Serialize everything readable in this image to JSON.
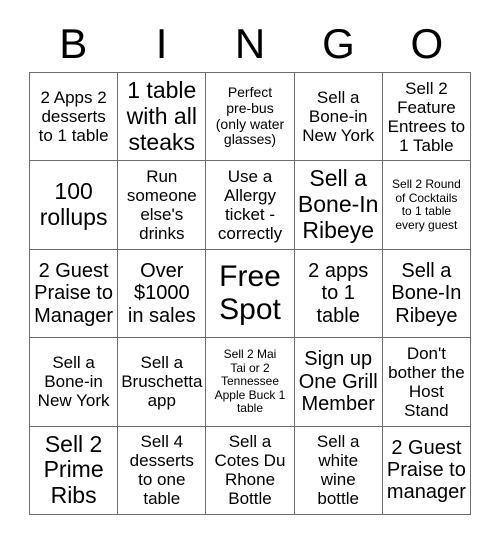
{
  "card": {
    "header_letters": [
      "B",
      "I",
      "N",
      "G",
      "O"
    ],
    "grid": {
      "columns": 5,
      "rows": 5,
      "border_color": "#6e6e6e",
      "background_color": "#ffffff",
      "text_color": "#000000"
    },
    "cells": [
      {
        "text": "2 Apps 2\ndesserts\nto 1 table",
        "size": "md",
        "free": false
      },
      {
        "text": "1 table\nwith all\nsteaks",
        "size": "xl",
        "free": false
      },
      {
        "text": "Perfect\npre-bus\n(only water\nglasses)",
        "size": "sm",
        "free": false
      },
      {
        "text": "Sell a\nBone-in\nNew York",
        "size": "md",
        "free": false
      },
      {
        "text": "Sell 2\nFeature\nEntrees to\n1 Table",
        "size": "md",
        "free": false
      },
      {
        "text": "100\nrollups",
        "size": "xl",
        "free": false
      },
      {
        "text": "Run\nsomeone\nelse's\ndrinks",
        "size": "md",
        "free": false
      },
      {
        "text": "Use a\nAllergy\nticket -\ncorrectly",
        "size": "md",
        "free": false
      },
      {
        "text": "Sell a\nBone-In\nRibeye",
        "size": "xl",
        "free": false
      },
      {
        "text": "Sell 2 Round\nof Cocktails\nto 1 table\nevery guest",
        "size": "xs",
        "free": false
      },
      {
        "text": "2 Guest\nPraise to\nManager",
        "size": "lg",
        "free": false
      },
      {
        "text": "Over\n$1000\nin sales",
        "size": "lg",
        "free": false
      },
      {
        "text": "Free\nSpot",
        "size": "xxl",
        "free": true
      },
      {
        "text": "2 apps\nto 1\ntable",
        "size": "lg",
        "free": false
      },
      {
        "text": "Sell a\nBone-In\nRibeye",
        "size": "lg",
        "free": false
      },
      {
        "text": "Sell a\nBone-in\nNew York",
        "size": "md",
        "free": false
      },
      {
        "text": "Sell a\nBruschetta\napp",
        "size": "md",
        "free": false
      },
      {
        "text": "Sell 2 Mai\nTai or 2\nTennessee\nApple Buck 1\ntable",
        "size": "xs",
        "free": false
      },
      {
        "text": "Sign up\nOne Grill\nMember",
        "size": "lg",
        "free": false
      },
      {
        "text": "Don't\nbother the\nHost\nStand",
        "size": "md",
        "free": false
      },
      {
        "text": "Sell 2\nPrime\nRibs",
        "size": "xl",
        "free": false
      },
      {
        "text": "Sell 4\ndesserts\nto one\ntable",
        "size": "md",
        "free": false
      },
      {
        "text": "Sell a\nCotes Du\nRhone\nBottle",
        "size": "md",
        "free": false
      },
      {
        "text": "Sell a\nwhite\nwine\nbottle",
        "size": "md",
        "free": false
      },
      {
        "text": "2 Guest\nPraise to\nmanager",
        "size": "lg",
        "free": false
      }
    ]
  }
}
